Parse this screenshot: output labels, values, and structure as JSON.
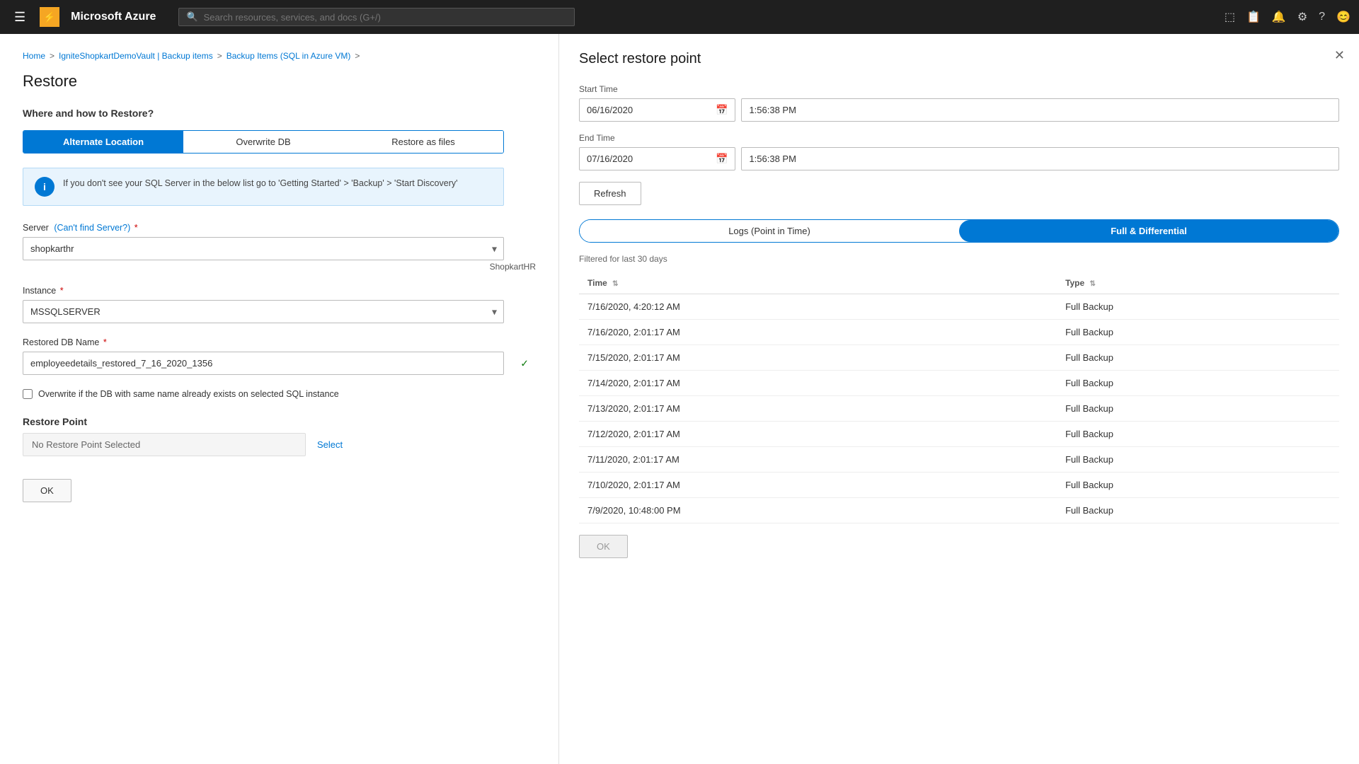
{
  "nav": {
    "hamburger_icon": "☰",
    "brand": "Microsoft Azure",
    "logo_char": "⚡",
    "search_placeholder": "Search resources, services, and docs (G+/)",
    "icons": [
      "&#9112;",
      "&#128438;",
      "&#128276;",
      "&#9881;",
      "&#63;",
      "&#128512;"
    ]
  },
  "breadcrumb": {
    "items": [
      {
        "label": "Home",
        "sep": false
      },
      {
        "label": ">",
        "sep": true
      },
      {
        "label": "IgniteShopkartDemoVault | Backup items",
        "sep": false
      },
      {
        "label": ">",
        "sep": true
      },
      {
        "label": "Backup Items (SQL in Azure VM)",
        "sep": false
      },
      {
        "label": ">",
        "sep": true
      }
    ]
  },
  "restore": {
    "page_title": "Restore",
    "section_heading": "Where and how to Restore?",
    "toggle_options": [
      {
        "label": "Alternate Location",
        "active": true
      },
      {
        "label": "Overwrite DB",
        "active": false
      },
      {
        "label": "Restore as files",
        "active": false
      }
    ],
    "info_text": "If you don't see your SQL Server in the below list go to 'Getting Started' > 'Backup' > 'Start Discovery'",
    "server_label": "Server",
    "server_link_text": "(Can't find Server?)",
    "server_value": "shopkarthr",
    "server_hint": "ShopkartHR",
    "instance_label": "Instance",
    "instance_value": "MSSQLSERVER",
    "db_name_label": "Restored DB Name",
    "db_name_value": "employeedetails_restored_7_16_2020_1356",
    "checkbox_label": "Overwrite if the DB with same name already exists on selected SQL instance",
    "restore_point_label": "Restore Point",
    "restore_point_placeholder": "No Restore Point Selected",
    "select_link": "Select",
    "ok_label": "OK"
  },
  "select_restore_point": {
    "panel_title": "Select restore point",
    "start_time_label": "Start Time",
    "start_date": "06/16/2020",
    "start_time": "1:56:38 PM",
    "end_time_label": "End Time",
    "end_date": "07/16/2020",
    "end_time": "1:56:38 PM",
    "refresh_label": "Refresh",
    "tab_logs": "Logs (Point in Time)",
    "tab_full": "Full & Differential",
    "filter_note": "Filtered for last 30 days",
    "table_headers": [
      {
        "label": "Time",
        "sortable": true
      },
      {
        "label": "Type",
        "sortable": true
      }
    ],
    "rows": [
      {
        "time": "7/16/2020, 4:20:12 AM",
        "type": "Full Backup"
      },
      {
        "time": "7/16/2020, 2:01:17 AM",
        "type": "Full Backup"
      },
      {
        "time": "7/15/2020, 2:01:17 AM",
        "type": "Full Backup"
      },
      {
        "time": "7/14/2020, 2:01:17 AM",
        "type": "Full Backup"
      },
      {
        "time": "7/13/2020, 2:01:17 AM",
        "type": "Full Backup"
      },
      {
        "time": "7/12/2020, 2:01:17 AM",
        "type": "Full Backup"
      },
      {
        "time": "7/11/2020, 2:01:17 AM",
        "type": "Full Backup"
      },
      {
        "time": "7/10/2020, 2:01:17 AM",
        "type": "Full Backup"
      },
      {
        "time": "7/9/2020, 10:48:00 PM",
        "type": "Full Backup"
      }
    ],
    "ok_label": "OK"
  }
}
